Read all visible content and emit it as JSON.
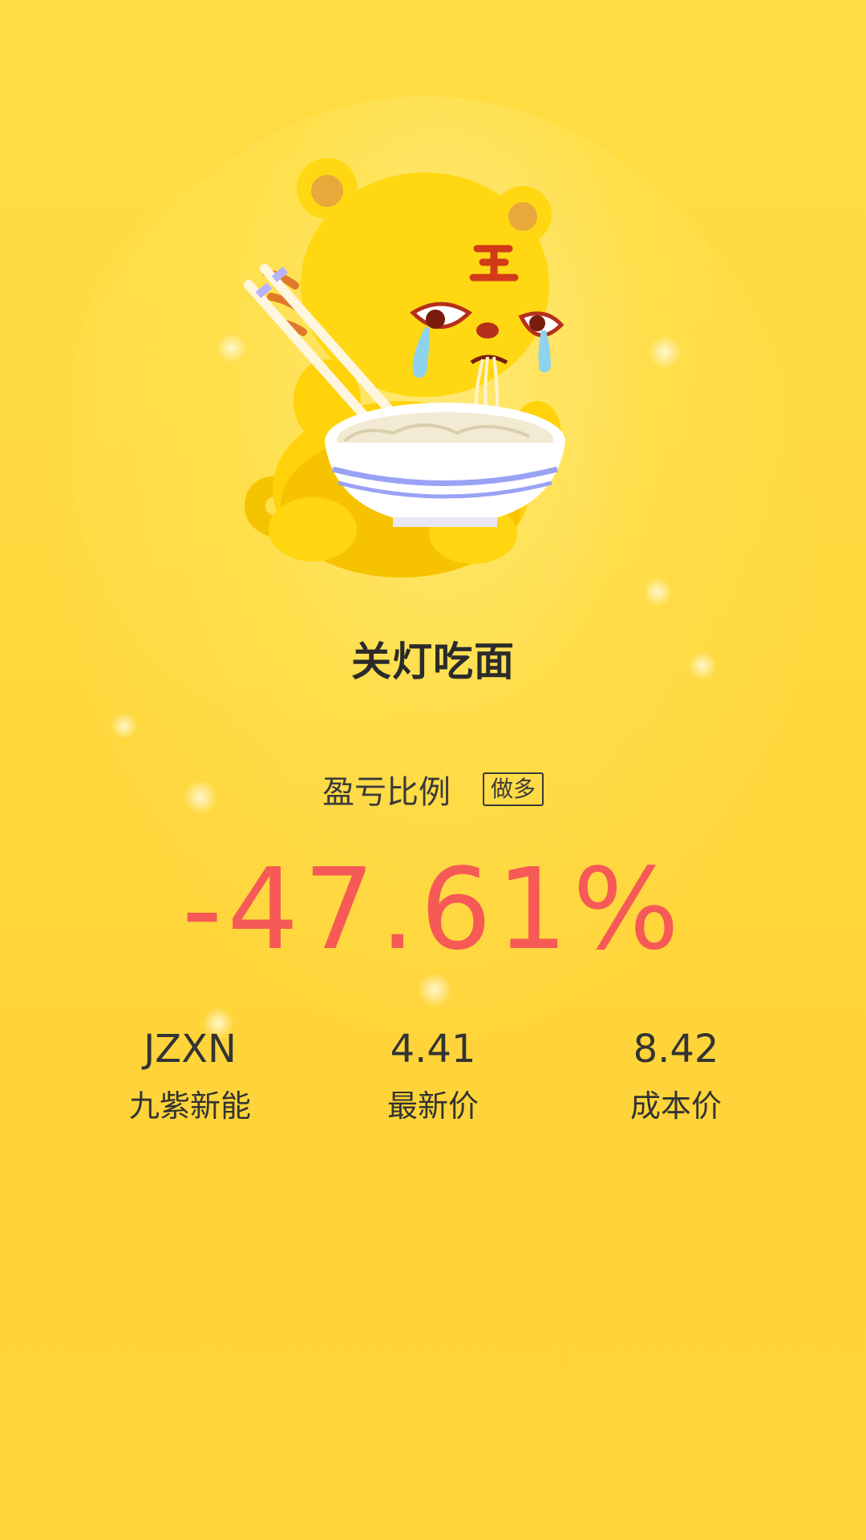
{
  "result": {
    "title": "关灯吃面"
  },
  "ratio": {
    "label": "盈亏比例",
    "direction_tag": "做多",
    "value": "-47.61%"
  },
  "stats": [
    {
      "value": "JZXN",
      "label": "九紫新能"
    },
    {
      "value": "4.41",
      "label": "最新价"
    },
    {
      "value": "8.42",
      "label": "成本价"
    }
  ],
  "colors": {
    "background": "#ffd83e",
    "loss_red": "#f65a56",
    "text_dark": "#333333"
  },
  "mascot": {
    "icon": "crying-tiger-eating-noodles"
  }
}
